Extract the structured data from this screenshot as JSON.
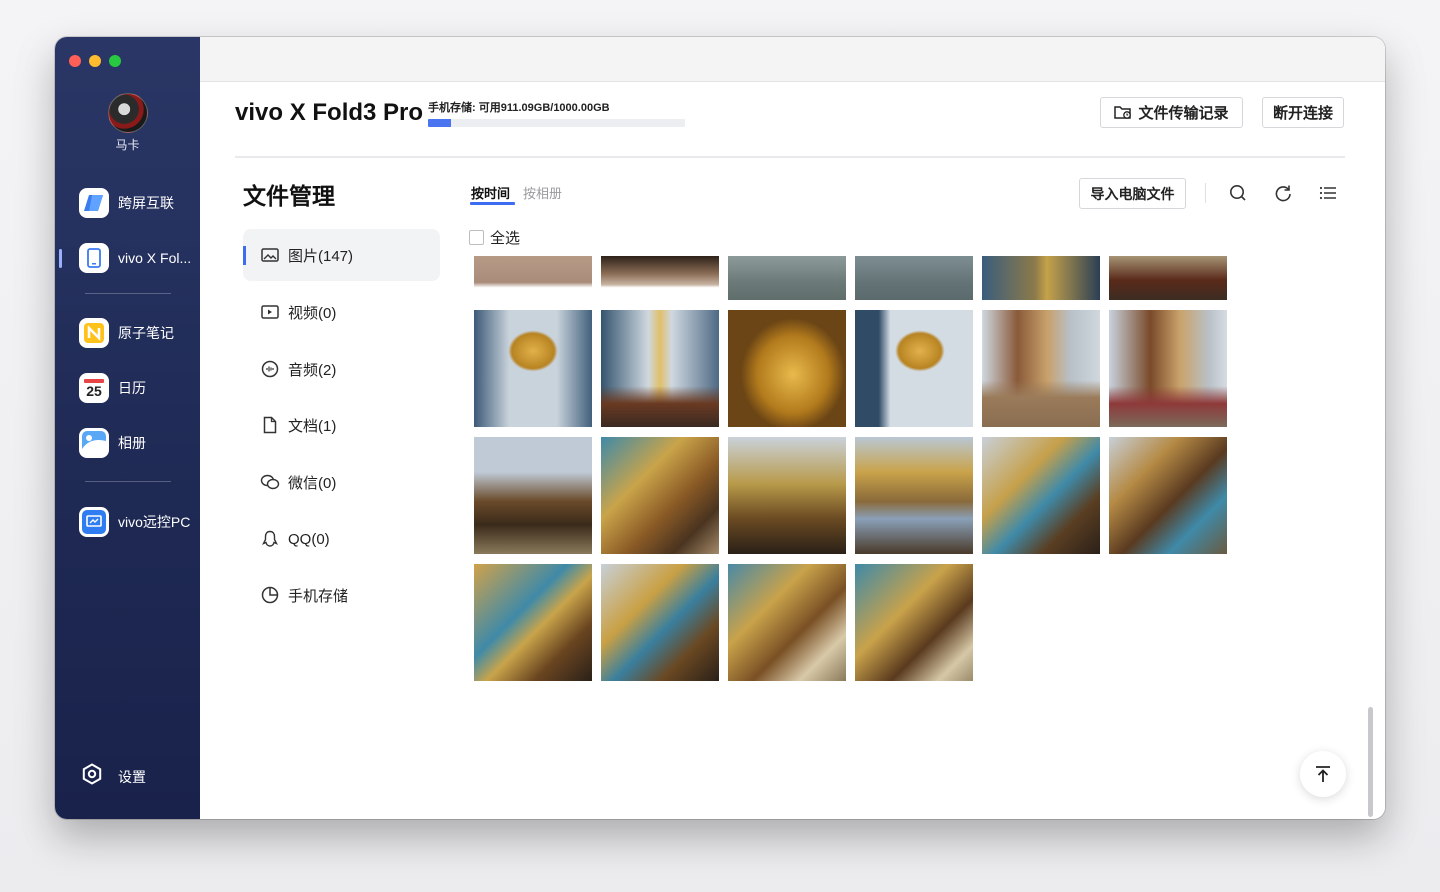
{
  "window": {
    "user_name": "马卡",
    "nav": [
      {
        "label": "跨屏互联",
        "icon": "cross-screen-icon"
      },
      {
        "label": "vivo X Fol...",
        "icon": "phone-icon"
      },
      {
        "label": "原子笔记",
        "icon": "notes-icon"
      },
      {
        "label": "日历",
        "icon": "calendar-icon",
        "day": "25"
      },
      {
        "label": "相册",
        "icon": "album-icon"
      },
      {
        "label": "vivo远控PC",
        "icon": "remote-pc-icon"
      }
    ],
    "settings_label": "设置"
  },
  "header": {
    "device_name": "vivo X Fold3 Pro",
    "storage_text": "手机存储: 可用911.09GB/1000.00GB",
    "storage_used_fraction": 0.089,
    "transfer_log_label": "文件传输记录",
    "disconnect_label": "断开连接"
  },
  "file_manager": {
    "title": "文件管理",
    "categories": [
      {
        "label": "图片(147)",
        "icon": "image-icon"
      },
      {
        "label": "视频(0)",
        "icon": "video-icon"
      },
      {
        "label": "音频(2)",
        "icon": "audio-icon"
      },
      {
        "label": "文档(1)",
        "icon": "document-icon"
      },
      {
        "label": "微信(0)",
        "icon": "wechat-icon"
      },
      {
        "label": "QQ(0)",
        "icon": "qq-icon"
      },
      {
        "label": "手机存储",
        "icon": "storage-pie-icon"
      }
    ],
    "tabs": [
      "按时间",
      "按相册"
    ],
    "import_label": "导入电脑文件",
    "select_all_label": "全选",
    "accent": "#3c6cf0"
  }
}
